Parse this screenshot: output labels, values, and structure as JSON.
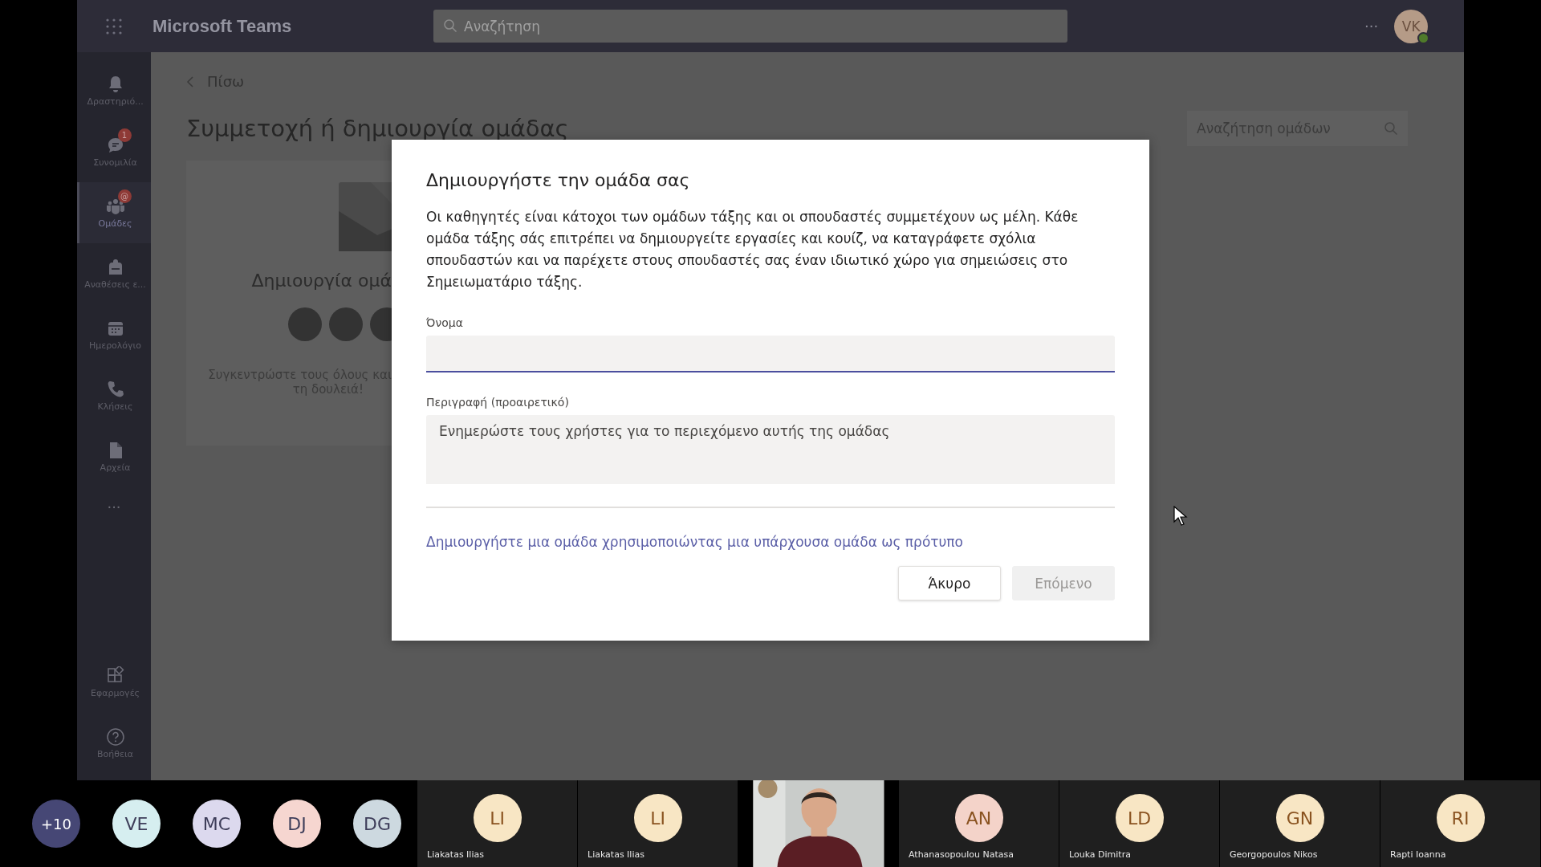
{
  "app": {
    "title": "Microsoft Teams",
    "search": {
      "placeholder": "Αναζήτηση"
    },
    "more": "···",
    "user": {
      "initials": "VK"
    }
  },
  "rail": {
    "items": [
      {
        "label": "Δραστηριό...",
        "selected": false
      },
      {
        "label": "Συνομιλία",
        "selected": false,
        "badge": "1"
      },
      {
        "label": "Ομάδες",
        "selected": true,
        "badge": "@"
      },
      {
        "label": "Αναθέσεις ε...",
        "selected": false
      },
      {
        "label": "Ημερολόγιο",
        "selected": false
      },
      {
        "label": "Κλήσεις",
        "selected": false
      },
      {
        "label": "Αρχεία",
        "selected": false
      }
    ],
    "more": "···",
    "bottom_items": [
      {
        "label": "Εφαρμογές",
        "selected": false
      },
      {
        "label": "Βοήθεια",
        "selected": false
      }
    ]
  },
  "page": {
    "back": "Πίσω",
    "title": "Συμμετοχή ή δημιουργία ομάδας",
    "team_search": {
      "placeholder": "Αναζήτηση ομάδων"
    },
    "card": {
      "title": "Δημιουργία ομά",
      "text_lines": [
        "Συγκεντρώστε τους όλους και",
        "τη δουλειά!"
      ]
    }
  },
  "dialog": {
    "title": "Δημιουργήστε την ομάδα σας",
    "description": "Οι καθηγητές είναι κάτοχοι των ομάδων τάξης και οι σπουδαστές συμμετέχουν ως μέλη. Κάθε ομάδα τάξης σάς επιτρέπει να δημιουργείτε εργασίες και κουίζ, να καταγράφετε σχόλια σπουδαστών και να παρέχετε στους σπουδαστές σας έναν ιδιωτικό χώρο για σημειώσεις στο Σημειωματάριο τάξης.",
    "name_label": "Όνομα",
    "name_field": {
      "focused": true
    },
    "description_label": "Περιγραφή (προαιρετικό)",
    "description_field": {
      "placeholder": "Ενημερώστε τους χρήστες για το περιεχόμενο αυτής της ομάδας"
    },
    "template_link": "Δημιουργήστε μια ομάδα χρησιμοποιώντας μια υπάρχουσα ομάδα ως πρότυπο",
    "buttons": [
      {
        "label": "Άκυρο",
        "disabled": false
      },
      {
        "label": "Επόμενο",
        "disabled": true
      }
    ]
  },
  "participants": {
    "bubbles": [
      {
        "initials": "+10",
        "color": "#464775"
      },
      {
        "initials": "VE",
        "color": "#d6eef0"
      },
      {
        "initials": "MC",
        "color": "#dcd9ee"
      },
      {
        "initials": "DJ",
        "color": "#f6d6d0"
      },
      {
        "initials": "DG",
        "color": "#cdd9e0"
      }
    ],
    "tiles": [
      {
        "kind": "avatar",
        "initials": "LI",
        "name": "Liakatas Ilias",
        "color": "#f8e6c4"
      },
      {
        "kind": "avatar",
        "initials": "LI",
        "name": "Liakatas Ilias",
        "color": "#f8e6c4"
      },
      {
        "kind": "picture"
      },
      {
        "kind": "avatar",
        "initials": "AN",
        "name": "Athanasopoulou Natasa",
        "color": "#f4d3c9"
      },
      {
        "kind": "avatar",
        "initials": "LD",
        "name": "Louka Dimitra",
        "color": "#f8e6c4"
      },
      {
        "kind": "avatar",
        "initials": "GN",
        "name": "Georgopoulos Nikos",
        "color": "#f8e6c4"
      },
      {
        "kind": "avatar",
        "initials": "RI",
        "name": "Rapti Ioanna",
        "color": "#f8e6c4"
      }
    ]
  }
}
